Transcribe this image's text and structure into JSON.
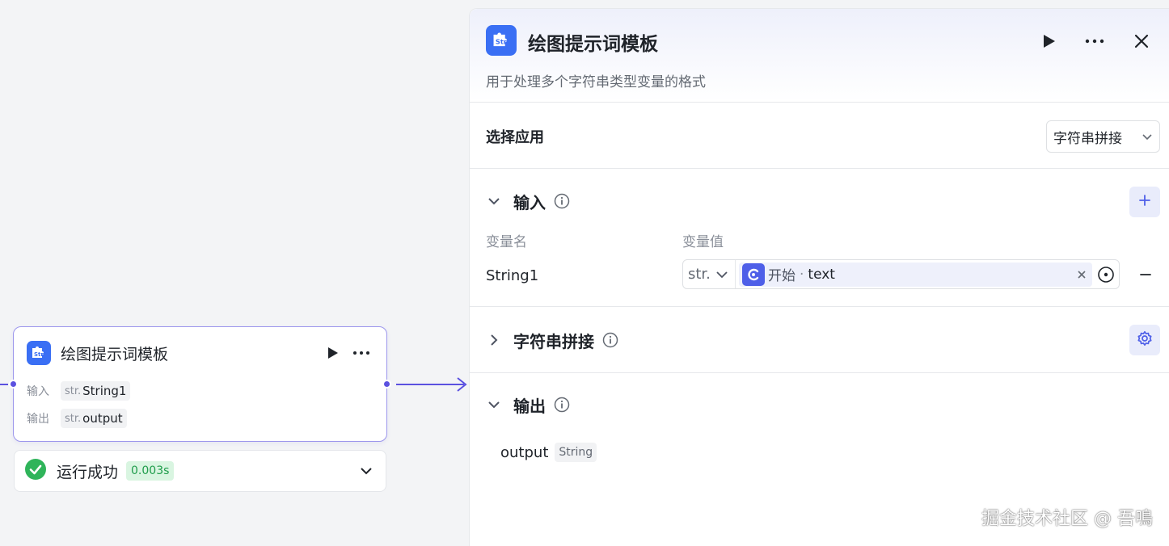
{
  "node": {
    "title": "绘图提示词模板",
    "input_label": "输入",
    "input_type": "str.",
    "input_value": "String1",
    "output_label": "输出",
    "output_type": "str.",
    "output_value": "output"
  },
  "status": {
    "text": "运行成功",
    "duration": "0.003s"
  },
  "panel": {
    "title": "绘图提示词模板",
    "description": "用于处理多个字符串类型变量的格式",
    "app_section": {
      "label": "选择应用",
      "selected": "字符串拼接"
    },
    "input_section": {
      "title": "输入",
      "col_name": "变量名",
      "col_value": "变量值",
      "rows": [
        {
          "name": "String1",
          "type": "str.",
          "ref_node": "开始",
          "ref_sep": "·",
          "ref_field": "text"
        }
      ]
    },
    "concat_section": {
      "title": "字符串拼接"
    },
    "output_section": {
      "title": "输出",
      "name": "output",
      "type": "String"
    }
  },
  "icons": {
    "app": "str-puzzle-icon",
    "run": "play-icon",
    "more": "more-horizontal-icon",
    "close": "close-icon",
    "success": "check-circle-icon",
    "chevron": "chevron-icon",
    "info": "info-icon",
    "add": "plus-icon",
    "remove": "minus-icon",
    "settings": "gear-icon",
    "var_pick": "target-icon"
  },
  "colors": {
    "accent": "#5b51e0",
    "app_icon": "#3a6ff4",
    "success": "#2fb45a",
    "success_bg": "#d9f5e1"
  },
  "watermark": "掘金技术社区 @ 吾鳴"
}
